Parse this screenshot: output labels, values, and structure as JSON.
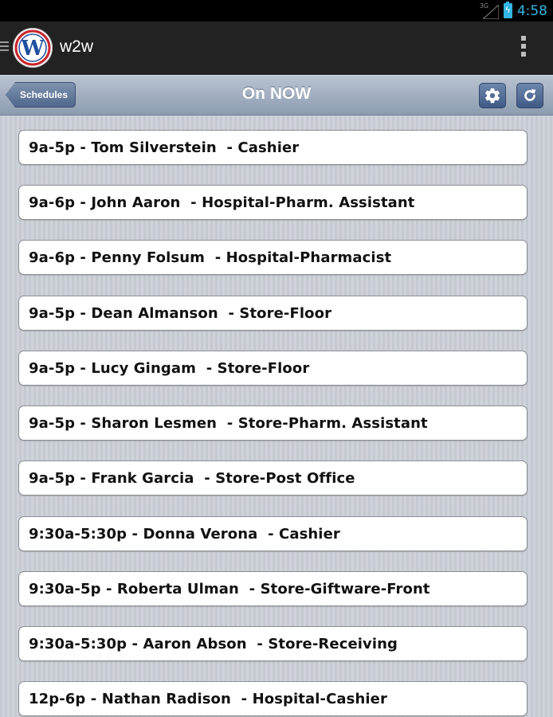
{
  "status_bar": {
    "network": "3G",
    "time": "4:58",
    "signal_icon": "signal-icon",
    "battery_icon": "battery-charging-icon"
  },
  "action_bar": {
    "app_name": "w2w",
    "logo_letter": "W",
    "menu_icon": "hamburger-icon",
    "overflow_icon": "overflow-menu-icon"
  },
  "toolbar": {
    "back_label": "Schedules",
    "title": "On NOW",
    "settings_icon": "gear-icon",
    "refresh_icon": "refresh-icon"
  },
  "shifts": [
    "9a-5p - Tom Silverstein  - Cashier",
    "9a-6p - John Aaron  - Hospital-Pharm. Assistant",
    "9a-6p - Penny Folsum  - Hospital-Pharmacist",
    "9a-5p - Dean Almanson  - Store-Floor",
    "9a-5p - Lucy Gingam  - Store-Floor",
    "9a-5p - Sharon Lesmen  - Store-Pharm. Assistant",
    "9a-5p - Frank Garcia  - Store-Post Office",
    "9:30a-5:30p - Donna Verona  - Cashier",
    "9:30a-5p - Roberta Ulman  - Store-Giftware-Front",
    "9:30a-5:30p - Aaron Abson  - Store-Receiving",
    "12p-6p - Nathan Radison  - Hospital-Cashier"
  ],
  "colors": {
    "accent": "#33b5e5",
    "toolbar_button": "#4f678b",
    "logo_red": "#c8242b",
    "logo_blue": "#1f4fa0"
  }
}
